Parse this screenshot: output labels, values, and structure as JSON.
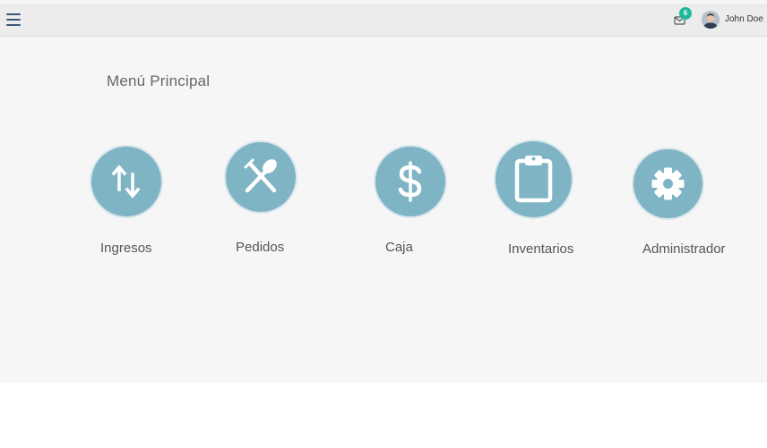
{
  "header": {
    "notification_count": "6",
    "user_name": "John Doe",
    "accent_color": "#1fb89a",
    "menu_icon": "hamburger-icon",
    "mail_icon": "envelope-icon"
  },
  "main": {
    "title": "Menú Principal",
    "tile_color": "#7fb4c5",
    "tiles": [
      {
        "label": "Ingresos",
        "icon": "arrows-up-down-icon"
      },
      {
        "label": "Pedidos",
        "icon": "fork-spoon-icon"
      },
      {
        "label": "Caja",
        "icon": "dollar-icon"
      },
      {
        "label": "Inventarios",
        "icon": "clipboard-icon"
      },
      {
        "label": "Administrador",
        "icon": "gear-icon"
      }
    ]
  }
}
